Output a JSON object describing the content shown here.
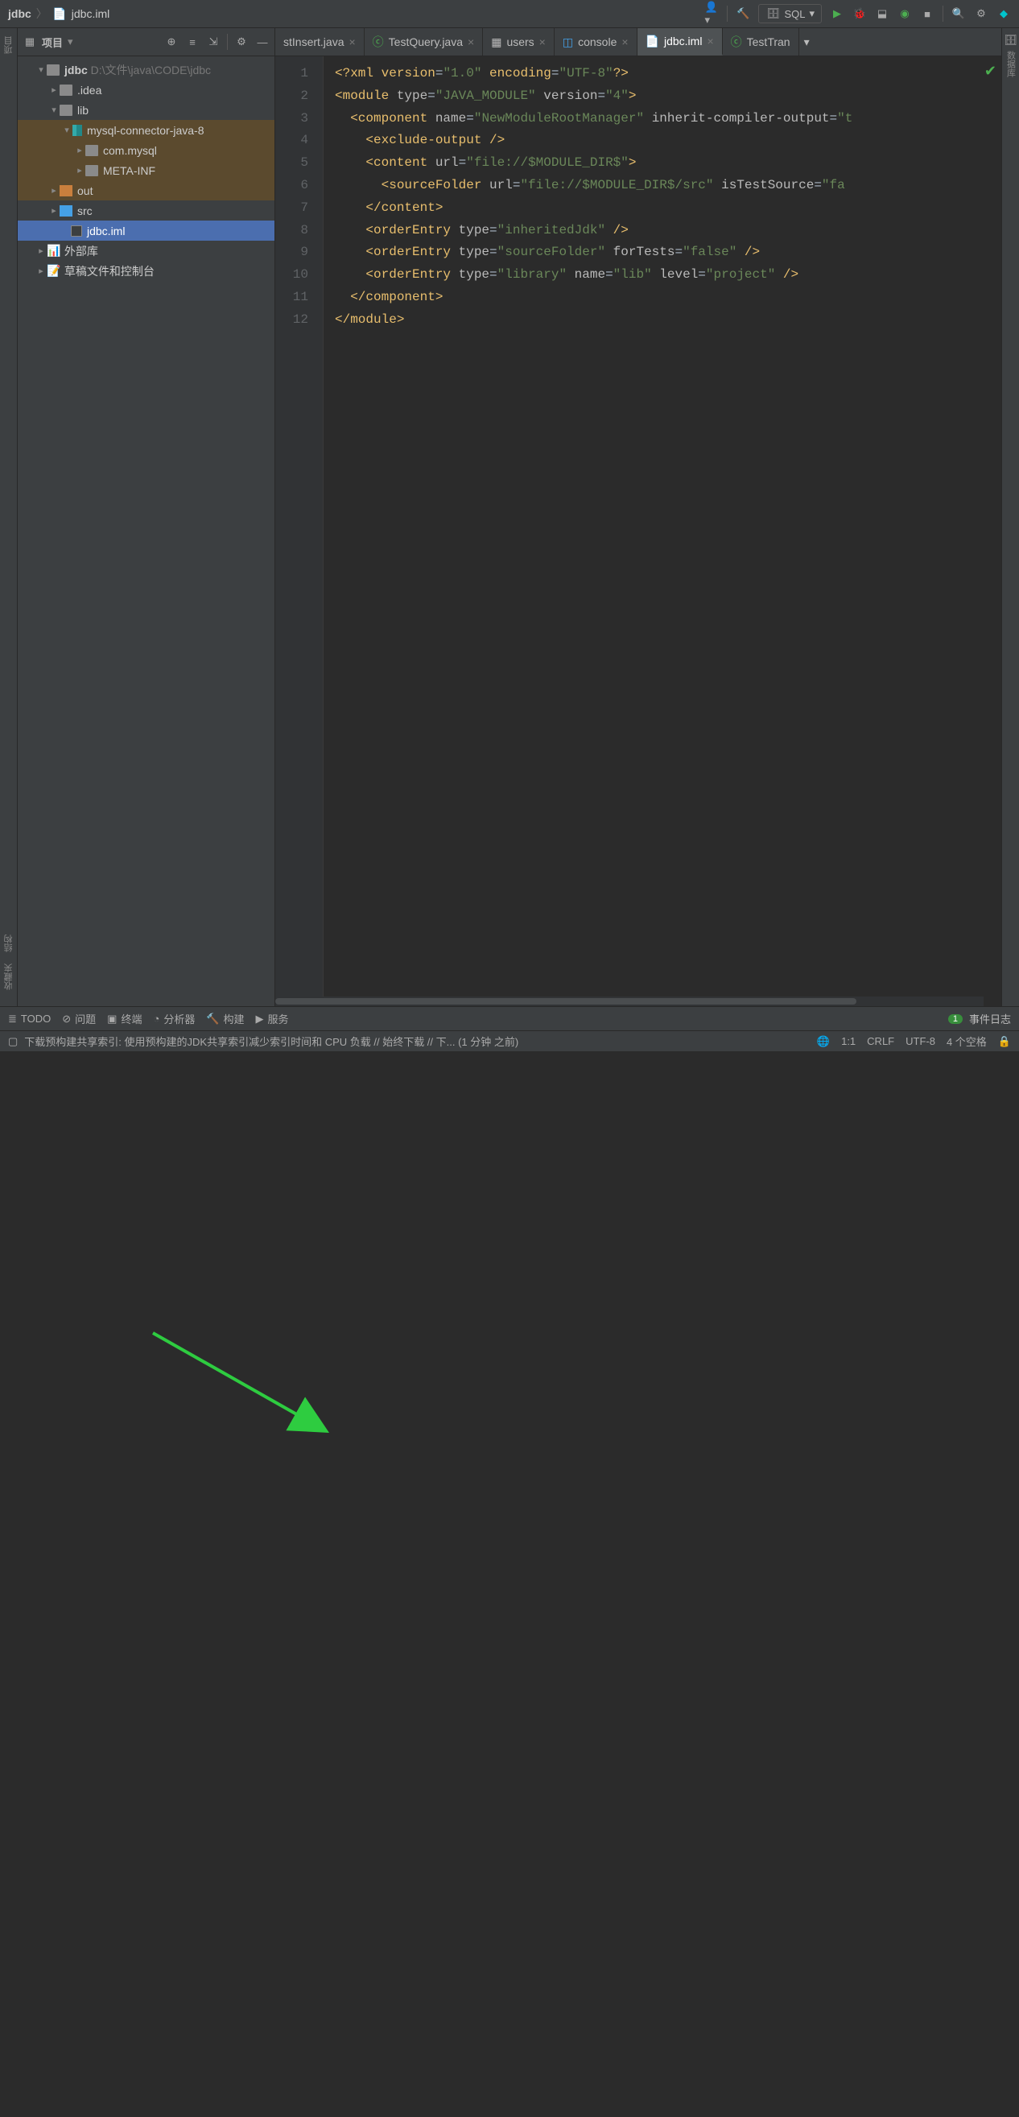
{
  "breadcrumb": {
    "root": "jdbc",
    "file": "jdbc.iml"
  },
  "runconfig": {
    "label": "SQL"
  },
  "sidebar": {
    "title": "项目",
    "tree": {
      "root": {
        "name": "jdbc",
        "path": "D:\\文件\\java\\CODE\\jdbc"
      },
      "idea": ".idea",
      "lib": "lib",
      "connector": "mysql-connector-java-8",
      "commysql": "com.mysql",
      "metainf": "META-INF",
      "out": "out",
      "src": "src",
      "iml": "jdbc.iml",
      "extlib": "外部库",
      "scratch": "草稿文件和控制台"
    }
  },
  "tabs": {
    "t0": "stInsert.java",
    "t1": "TestQuery.java",
    "t2": "users",
    "t3": "console",
    "t4": "jdbc.iml",
    "t5": "TestTran"
  },
  "code": {
    "l1": {
      "a": "<?",
      "b": "xml version",
      "c": "=",
      "d": "\"1.0\"",
      "e": " encoding",
      "f": "=",
      "g": "\"UTF-8\"",
      "h": "?>"
    },
    "l2": {
      "a": "<module ",
      "b": "type",
      "c": "=",
      "d": "\"JAVA_MODULE\" ",
      "e": "version",
      "f": "=",
      "g": "\"4\"",
      "h": ">"
    },
    "l3": {
      "a": "  <component ",
      "b": "name",
      "c": "=",
      "d": "\"NewModuleRootManager\" ",
      "e": "inherit-compiler-output",
      "f": "=",
      "g": "\"t"
    },
    "l4": {
      "a": "    <exclude-output />"
    },
    "l5": {
      "a": "    <content ",
      "b": "url",
      "c": "=",
      "d": "\"file://$MODULE_DIR$\"",
      "e": ">"
    },
    "l6": {
      "a": "      <sourceFolder ",
      "b": "url",
      "c": "=",
      "d": "\"file://$MODULE_DIR$/src\" ",
      "e": "isTestSource",
      "f": "=",
      "g": "\"fa"
    },
    "l7": {
      "a": "    </content>"
    },
    "l8": {
      "a": "    <orderEntry ",
      "b": "type",
      "c": "=",
      "d": "\"inheritedJdk\" ",
      "e": "/>"
    },
    "l9": {
      "a": "    <orderEntry ",
      "b": "type",
      "c": "=",
      "d": "\"sourceFolder\" ",
      "e": "forTests",
      "f": "=",
      "g": "\"false\" ",
      "h": "/>"
    },
    "l10": {
      "a": "    <orderEntry ",
      "b": "type",
      "c": "=",
      "d": "\"library\" ",
      "e": "name",
      "f": "=",
      "g": "\"lib\" ",
      "h": "level",
      "i": "=",
      "j": "\"project\" ",
      "k": "/>"
    },
    "l11": {
      "a": "  </component>"
    },
    "l12": {
      "a": "</module>"
    }
  },
  "lines": {
    "1": "1",
    "2": "2",
    "3": "3",
    "4": "4",
    "5": "5",
    "6": "6",
    "7": "7",
    "8": "8",
    "9": "9",
    "10": "10",
    "11": "11",
    "12": "12"
  },
  "toolwindows": {
    "todo": "TODO",
    "problems": "问题",
    "terminal": "终端",
    "profiler": "分析器",
    "build": "构建",
    "services": "服务",
    "badge": "1",
    "eventlog": "事件日志"
  },
  "status": {
    "msg": "下载预构建共享索引: 使用预构建的JDK共享索引减少索引时间和 CPU 负载 // 始终下载 // 下... (1 分钟 之前)",
    "pos": "1:1",
    "crlf": "CRLF",
    "enc": "UTF-8",
    "indent": "4 个空格"
  },
  "rightlabel": "数据库",
  "leftlabel1": "项目",
  "leftlabel2": "结构",
  "leftlabel3": "收藏夹"
}
